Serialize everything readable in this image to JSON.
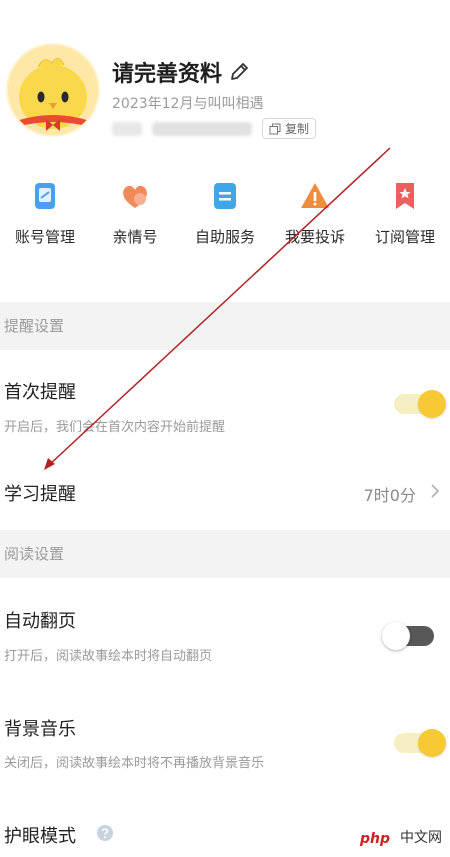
{
  "profile": {
    "name": "请完善资料",
    "since": "2023年12月与叫叫相遇",
    "copy_label": "复制"
  },
  "shortcuts": [
    {
      "label": "账号管理",
      "icon": "account-icon",
      "color": "#4aa0f0"
    },
    {
      "label": "亲情号",
      "icon": "family-heart-icon",
      "color": "#f08a5a"
    },
    {
      "label": "自助服务",
      "icon": "self-service-icon",
      "color": "#3fa7e8"
    },
    {
      "label": "我要投诉",
      "icon": "complaint-warning-icon",
      "color": "#f08d3c"
    },
    {
      "label": "订阅管理",
      "icon": "subscription-icon",
      "color": "#ee5f5f"
    }
  ],
  "sections": {
    "reminder": {
      "header": "提醒设置",
      "first_reminder": {
        "title": "首次提醒",
        "desc": "开启后，我们会在首次内容开始前提醒",
        "enabled": true
      },
      "study_reminder": {
        "title": "学习提醒",
        "value": "7时0分"
      }
    },
    "reading": {
      "header": "阅读设置",
      "auto_page": {
        "title": "自动翻页",
        "desc": "打开后，阅读故事绘本时将自动翻页",
        "enabled": false
      },
      "bg_music": {
        "title": "背景音乐",
        "desc": "关闭后，阅读故事绘本时将不再播放背景音乐",
        "enabled": true
      },
      "eye_care": {
        "title": "护眼模式"
      }
    }
  },
  "watermark": {
    "brand": "php",
    "site": "中文网"
  },
  "colors": {
    "toggle_on": "#f7c932",
    "toggle_off": "#585858",
    "annotation": "#b22222"
  }
}
